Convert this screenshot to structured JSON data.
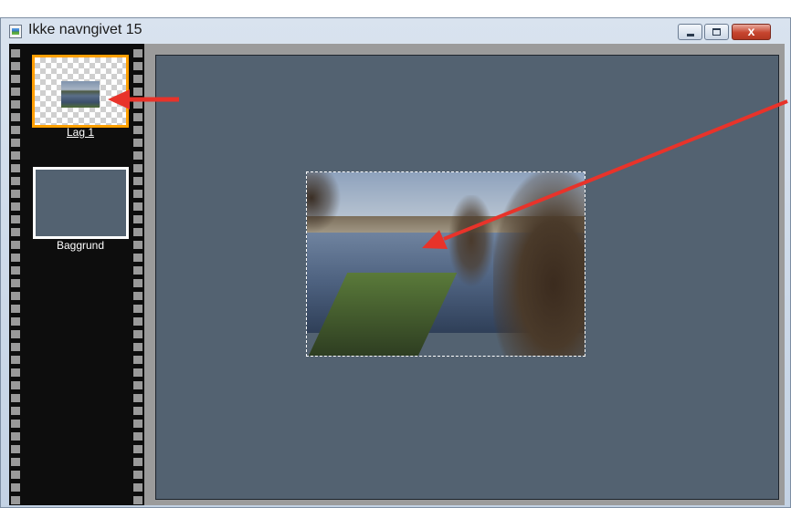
{
  "window": {
    "title": "Ikke navngivet 15",
    "icon": "document-image-icon",
    "controls": {
      "minimize_icon": "minimize-icon",
      "maximize_icon": "maximize-icon",
      "close_icon": "close-icon",
      "close_glyph": "x"
    }
  },
  "layers": [
    {
      "label": "Lag 1",
      "selected": true
    },
    {
      "label": "Baggrund",
      "selected": false
    }
  ],
  "colors": {
    "canvas_background": "#536271",
    "filmstrip": "#0d0d0d",
    "selection_border": "#ff9f00",
    "annotation_arrow": "#e8332a"
  }
}
